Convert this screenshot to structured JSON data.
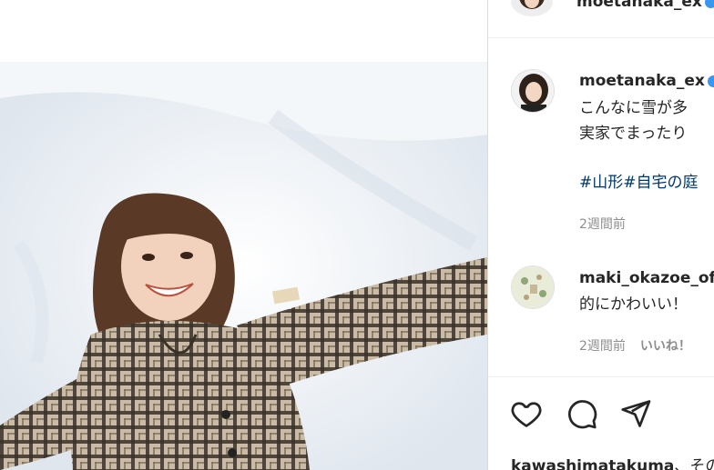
{
  "header": {
    "username": "moetanaka_ex"
  },
  "caption": {
    "username": "moetanaka_ex",
    "line1": "こんなに雪が多",
    "line2": "実家でまったり",
    "hashtags": "#山形#自宅の庭",
    "time": "2週間前"
  },
  "comment": {
    "username": "maki_okazoe_of",
    "text": "的にかわいい！",
    "time": "2週間前",
    "like_label": "いいね！"
  },
  "actions": {
    "like_icon": "heart-icon",
    "comment_icon": "comment-icon",
    "share_icon": "send-icon"
  },
  "liked_by": {
    "user": "kawashimatakuma",
    "rest": "、その"
  },
  "colors": {
    "hashtag": "#00376b",
    "verified": "#3897f0",
    "meta": "#8e8e8e",
    "border": "#dbdbdb"
  }
}
